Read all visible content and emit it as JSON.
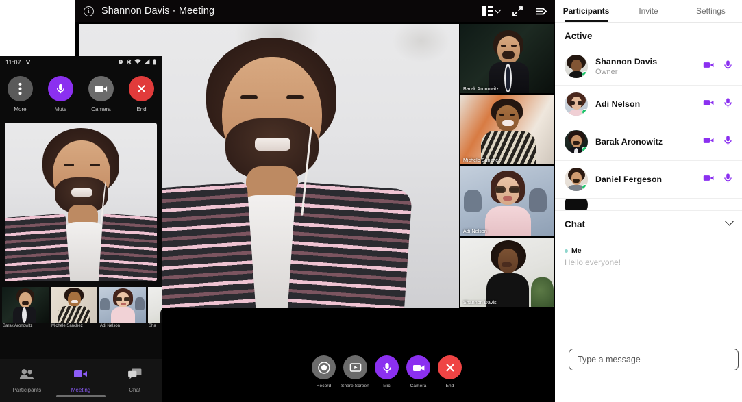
{
  "desktop": {
    "titlebar": {
      "info_icon": "info-icon",
      "title": "Shannon Davis - Meeting",
      "layout_icon": "layout-grid-icon",
      "layout_chevron": "chevron-down-icon",
      "fullscreen_icon": "expand-fullscreen-icon",
      "leave_icon": "exit-arrow-icon"
    },
    "main_video": {
      "speaker": "Shannon Davis - Meeting"
    },
    "thumbnails": [
      {
        "name": "Barak Aronowitz"
      },
      {
        "name": "Michele Sanchez"
      },
      {
        "name": "Adi Nelson"
      },
      {
        "name": "Shannon Davis"
      }
    ],
    "controls": [
      {
        "label": "Record",
        "icon": "record-icon",
        "color": "#6b6b6b"
      },
      {
        "label": "Share Screen",
        "icon": "share-screen-icon",
        "color": "#6b6b6b"
      },
      {
        "label": "Mic",
        "icon": "mic-icon",
        "color": "#8b30f0"
      },
      {
        "label": "Camera",
        "icon": "camera-icon",
        "color": "#8b30f0"
      },
      {
        "label": "End",
        "icon": "end-call-icon",
        "color": "#ef4444"
      }
    ]
  },
  "panel": {
    "tabs": [
      {
        "label": "Participants",
        "active": true
      },
      {
        "label": "Invite",
        "active": false
      },
      {
        "label": "Settings",
        "active": false
      }
    ],
    "section_title": "Active",
    "participants": [
      {
        "name": "Shannon Davis",
        "role": "Owner",
        "online": true,
        "camera": "camera-icon",
        "mic": "mic-icon"
      },
      {
        "name": "Adi Nelson",
        "role": "",
        "online": true,
        "camera": "camera-icon",
        "mic": "mic-icon"
      },
      {
        "name": "Barak Aronowitz",
        "role": "",
        "online": true,
        "camera": "camera-icon",
        "mic": "mic-icon"
      },
      {
        "name": "Daniel Fergeson",
        "role": "",
        "online": true,
        "camera": "camera-icon",
        "mic": "mic-icon"
      }
    ],
    "chat": {
      "title": "Chat",
      "collapse_icon": "chevron-down-icon",
      "messages": [
        {
          "author": "Me",
          "text": "Hello everyone!"
        }
      ],
      "input_placeholder": "Type a message"
    }
  },
  "phone": {
    "statusbar": {
      "time": "11:07",
      "carrier": "V",
      "icons": [
        "alarm-icon",
        "bluetooth-icon",
        "wifi-icon",
        "signal-icon",
        "battery-icon"
      ]
    },
    "controls": [
      {
        "label": "More",
        "icon": "more-dots-icon",
        "color": "#5a5a5a"
      },
      {
        "label": "Mute",
        "icon": "mic-icon",
        "color": "#8b30f0"
      },
      {
        "label": "Camera",
        "icon": "camera-icon",
        "color": "#6b6b6b"
      },
      {
        "label": "End",
        "icon": "end-call-icon",
        "color": "#e13b3b"
      }
    ],
    "thumbnails": [
      {
        "name": "Barak Aronowitz"
      },
      {
        "name": "Michele Sanchez"
      },
      {
        "name": "Adi Nelson"
      },
      {
        "name": "Sha"
      }
    ],
    "nav": [
      {
        "label": "Participants",
        "icon": "participants-icon",
        "active": false
      },
      {
        "label": "Meeting",
        "icon": "camera-icon",
        "active": true
      },
      {
        "label": "Chat",
        "icon": "chat-icon",
        "active": false
      }
    ]
  },
  "colors": {
    "accent_purple": "#8b30f0",
    "nav_purple": "#8b5cf6",
    "end_red": "#ef4444",
    "online_green": "#1ec36a",
    "panel_bg": "#ffffff",
    "window_bg": "#000000"
  }
}
